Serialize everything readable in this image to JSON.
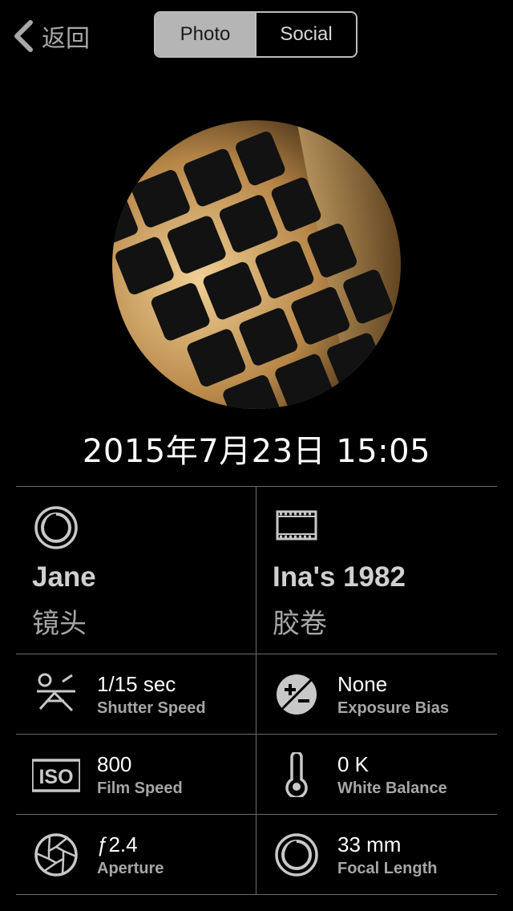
{
  "nav": {
    "back_label": "返回",
    "segments": [
      {
        "label": "Photo",
        "active": true
      },
      {
        "label": "Social",
        "active": false
      }
    ]
  },
  "photo": {
    "description_icon": "keyboard-photo"
  },
  "datetime": "2015年7月23日 15:05",
  "lens": {
    "value": "Jane",
    "label": "镜头",
    "icon": "lens-icon"
  },
  "film": {
    "value": "Ina's 1982",
    "label": "胶卷",
    "icon": "film-icon"
  },
  "specs": [
    {
      "value": "1/15 sec",
      "label": "Shutter Speed",
      "icon": "shutter-speed-icon"
    },
    {
      "value": "None",
      "label": "Exposure Bias",
      "icon": "exposure-bias-icon"
    },
    {
      "value": "800",
      "label": "Film Speed",
      "icon": "iso-icon"
    },
    {
      "value": "0 K",
      "label": "White Balance",
      "icon": "thermometer-icon"
    },
    {
      "value": "ƒ2.4",
      "label": "Aperture",
      "icon": "aperture-icon"
    },
    {
      "value": "33 mm",
      "label": "Focal Length",
      "icon": "focal-length-icon"
    }
  ],
  "colors": {
    "background": "#000000",
    "label_gray": "#a6a6a6",
    "segment_active": "#b5b5b5"
  }
}
